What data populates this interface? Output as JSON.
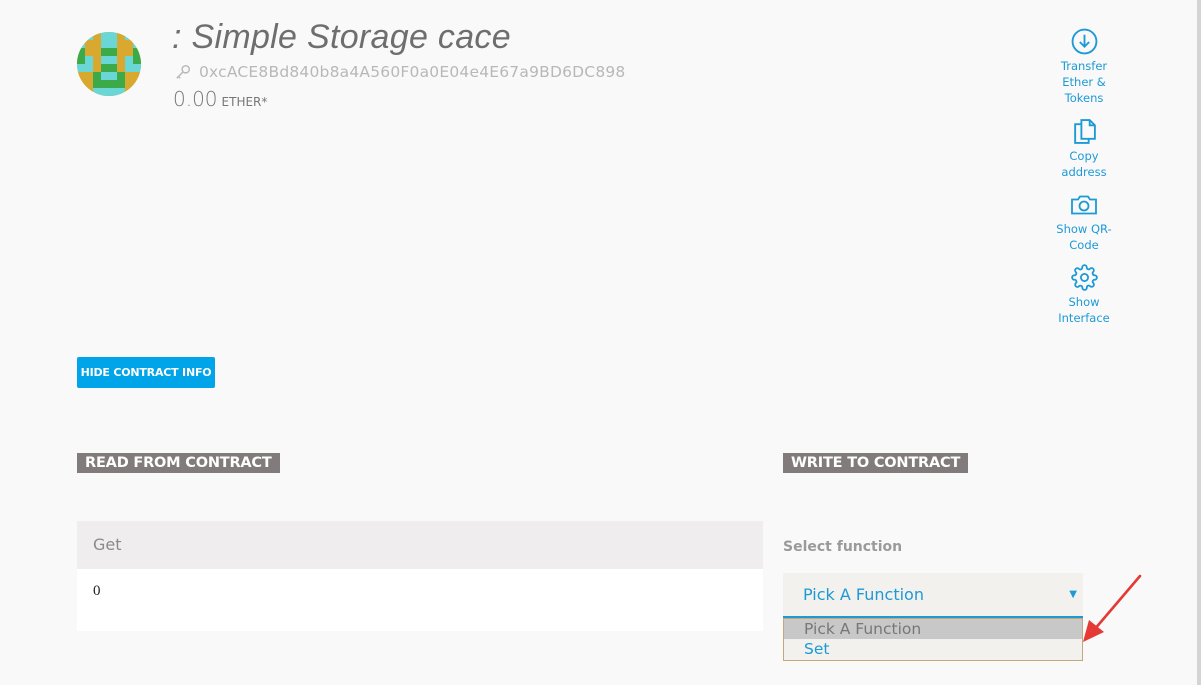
{
  "header": {
    "title": ": Simple Storage cace",
    "address": "0xcACE8Bd840b8a4A560F0a0E04e4E67a9BD6DC898",
    "balance_amount": "0.00",
    "balance_unit": "ETHER*",
    "avatar_icon": "identicon-avatar",
    "key_icon": "key-icon"
  },
  "actions": [
    {
      "icon": "arrow-down-circle-icon",
      "label": "Transfer Ether & Tokens"
    },
    {
      "icon": "copy-document-icon",
      "label": "Copy address"
    },
    {
      "icon": "camera-icon",
      "label": "Show QR-Code"
    },
    {
      "icon": "gear-icon",
      "label": "Show Interface"
    }
  ],
  "hide_button": {
    "label": "HIDE CONTRACT INFO"
  },
  "read": {
    "heading": "READ FROM CONTRACT",
    "functions": [
      {
        "name": "Get",
        "value": "0"
      }
    ]
  },
  "write": {
    "heading": "WRITE TO CONTRACT",
    "select_label": "Select function",
    "selected": "Pick A Function",
    "options": [
      "Pick A Function",
      "Set"
    ]
  },
  "colors": {
    "accent": "#1d9ad6",
    "button": "#00a4e8",
    "heading_bg": "#817b7b",
    "annotation": "#e53935"
  }
}
